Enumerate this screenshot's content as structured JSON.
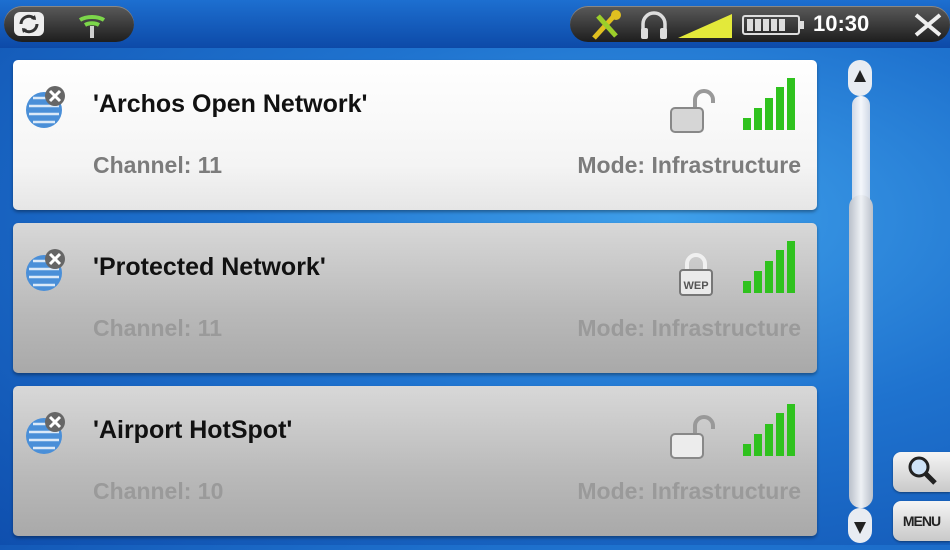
{
  "status_bar": {
    "time": "10:30",
    "icons": [
      "sync-icon",
      "wifi-hotspot-icon",
      "settings-tools-icon",
      "headphones-icon",
      "volume-icon",
      "battery-icon",
      "close-icon"
    ]
  },
  "networks": [
    {
      "name": "'Archos Open Network'",
      "channel": "Channel: 11",
      "mode": "Mode: Infrastructure",
      "security": "open",
      "selected": true
    },
    {
      "name": "'Protected Network'",
      "channel": "Channel: 11",
      "mode": "Mode: Infrastructure",
      "security": "wep",
      "wep_label": "WEP",
      "selected": false
    },
    {
      "name": "'Airport HotSpot'",
      "channel": "Channel: 10",
      "mode": "Mode: Infrastructure",
      "security": "open",
      "selected": false
    }
  ],
  "side_buttons": {
    "search": "search-icon",
    "menu_label": "MENU"
  },
  "colors": {
    "signal": "#2fc21e",
    "selected_row": "#ffffff",
    "row": "#bdbdbd",
    "background": "#1f73cf"
  }
}
